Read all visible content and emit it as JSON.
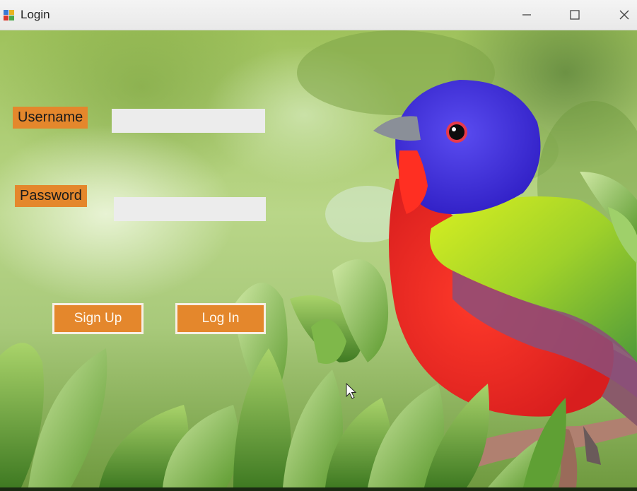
{
  "window": {
    "title": "Login",
    "app_icon": "windows-forms-app-icon",
    "controls": {
      "minimize_icon": "minimize-icon",
      "maximize_icon": "maximize-icon",
      "close_icon": "close-icon"
    }
  },
  "form": {
    "username_label": "Username",
    "username_value": "",
    "password_label": "Password",
    "password_value": "",
    "signup_label": "Sign Up",
    "login_label": "Log In"
  },
  "colors": {
    "label_bg": "#e4872c",
    "button_bg": "#e4872c",
    "field_bg": "#ececec"
  }
}
